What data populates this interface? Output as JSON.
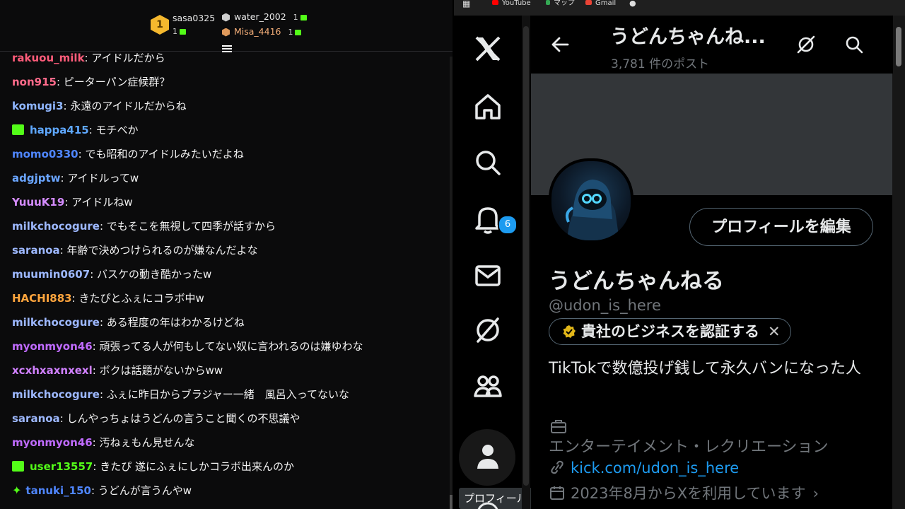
{
  "leaderboard": {
    "first": {
      "rank": "1",
      "name": "sasa0325",
      "count": "1"
    },
    "second": {
      "name": "water_2002",
      "count": "1"
    },
    "third": {
      "name": "Misa_4416",
      "count": "1"
    }
  },
  "chat": {
    "messages": [
      {
        "user": "rakuou_milk",
        "color": "#ff5c7a",
        "text": ": アイドルだから"
      },
      {
        "user": "non915",
        "color": "#ff6b8b",
        "text": ": ピーターパン症候群？"
      },
      {
        "user": "komugi3",
        "color": "#8fb6ff",
        "text": ": 永遠のアイドルだからね"
      },
      {
        "user": "happa415",
        "color": "#5fa8ff",
        "text": ": モチベか"
      },
      {
        "user": "momo0330",
        "color": "#4f86ff",
        "text": ": でも昭和のアイドルみたいだよね"
      },
      {
        "user": "adgjptw",
        "color": "#6aa5ff",
        "text": ": アイドルってw"
      },
      {
        "user": "YuuuK19",
        "color": "#d58cff",
        "text": ": アイドルねw"
      },
      {
        "user": "milkchocogure",
        "color": "#9db8ff",
        "text": ": でもそこを無視して四季が話すから"
      },
      {
        "user": "saranoa",
        "color": "#9db8ff",
        "text": ": 年齢で決めつけられるのが嫌なんだよな"
      },
      {
        "user": "muumin0607",
        "color": "#9db8ff",
        "text": ": バスケの動き酷かったw"
      },
      {
        "user": "HACHI883",
        "color": "#ffa53d",
        "text": ": きたぴとふぇにコラボ中w"
      },
      {
        "user": "milkchocogure",
        "color": "#9db8ff",
        "text": ": ある程度の年はわかるけどね"
      },
      {
        "user": "myonmyon46",
        "color": "#c06bff",
        "text": ": 頑張ってる人が何もしてない奴に言われるのは嫌ゆわな"
      },
      {
        "user": "xcxhxaxnxexl",
        "color": "#d080ff",
        "text": ": ボクは話題がないからww"
      },
      {
        "user": "milkchocogure",
        "color": "#9db8ff",
        "text": ": ふぇに昨日からブラジャー一緒　風呂入ってないな"
      },
      {
        "user": "saranoa",
        "color": "#9db8ff",
        "text": ": しんやっちょはうどんの言うこと聞くの不思議や"
      },
      {
        "user": "myonmyon46",
        "color": "#c06bff",
        "text": ": 汚ねぇもん見せんな"
      },
      {
        "user": "user13557",
        "color": "#53fc18",
        "text": ": きたぴ 遂にふぇにしかコラボ出来んのか"
      },
      {
        "user": "tanuki_150",
        "color": "#4f86ff",
        "text": ": うどんが言うんやw"
      }
    ]
  },
  "bookmarks": {
    "youtube": "YouTube",
    "maps": "マップ",
    "gmail": "Gmail"
  },
  "x": {
    "notifications_count": "6",
    "tooltip": "プロフィール",
    "header": {
      "title": "うどんちゃんね...",
      "post_count": "3,781 件のポスト"
    },
    "profile": {
      "edit_button": "プロフィールを編集",
      "display_name": "うどんちゃんねる",
      "handle": "@udon_is_here",
      "verify_chip": "貴社のビジネスを認証する",
      "bio": "TikTokで数億投げ銭して永久バンになった人",
      "category": "エンターテイメント・レクリエーション",
      "link": "kick.com/udon_is_here",
      "joined": "2023年8月からXを利用しています"
    }
  }
}
